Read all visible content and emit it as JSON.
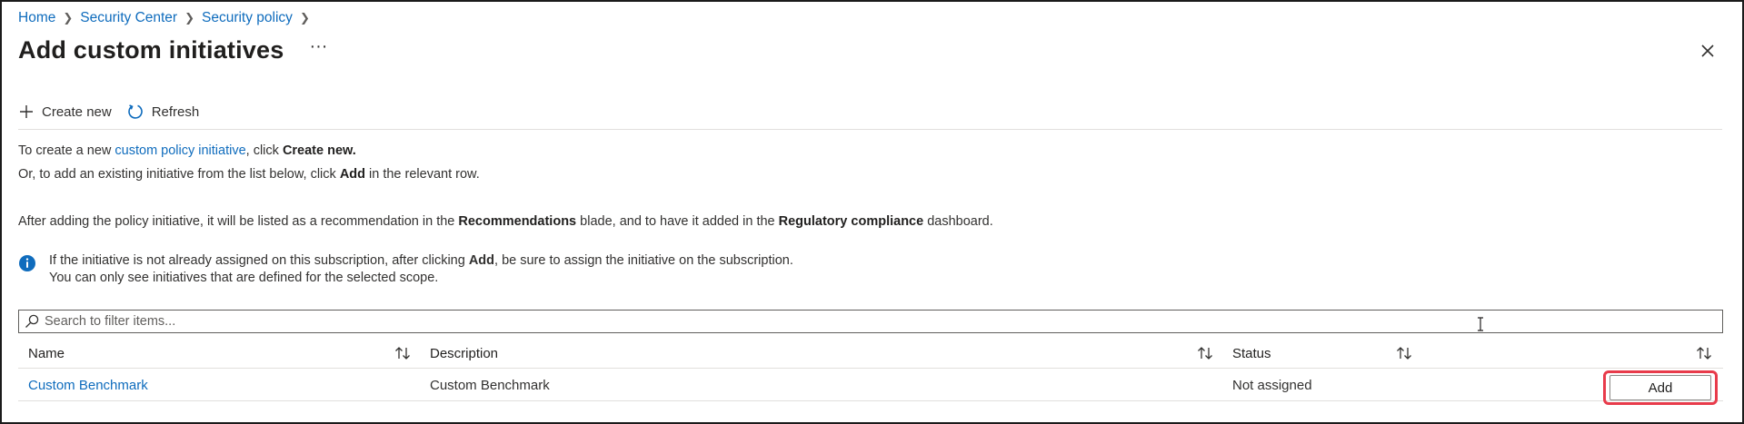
{
  "breadcrumb": [
    "Home",
    "Security Center",
    "Security policy"
  ],
  "page": {
    "title": "Add custom initiatives",
    "more_label": "···"
  },
  "toolbar": {
    "create_label": "Create new",
    "refresh_label": "Refresh"
  },
  "intro": {
    "line1_prefix": "To create a new ",
    "line1_link": "custom policy initiative",
    "line1_mid": ", click ",
    "line1_bold": "Create new.",
    "line2_prefix": "Or, to add an existing initiative from the list below, click ",
    "line2_bold": "Add",
    "line2_suffix": " in the relevant row.",
    "line3_prefix": "After adding the policy initiative, it will be listed as a recommendation in the ",
    "line3_bold1": "Recommendations",
    "line3_mid": " blade, and to have it added in the ",
    "line3_bold2": "Regulatory compliance",
    "line3_suffix": " dashboard."
  },
  "info": {
    "line1_prefix": "If the initiative is not already assigned on this subscription, after clicking ",
    "line1_bold": "Add",
    "line1_suffix": ", be sure to assign the initiative on the subscription.",
    "line2": "You can only see initiatives that are defined for the selected scope."
  },
  "search": {
    "placeholder": "Search to filter items..."
  },
  "table": {
    "columns": [
      "Name",
      "Description",
      "Status"
    ],
    "rows": [
      {
        "name": "Custom Benchmark",
        "description": "Custom Benchmark",
        "status": "Not assigned",
        "action": "Add"
      }
    ]
  },
  "colors": {
    "accent": "#0f6cbd",
    "highlight": "#e83b4b"
  }
}
